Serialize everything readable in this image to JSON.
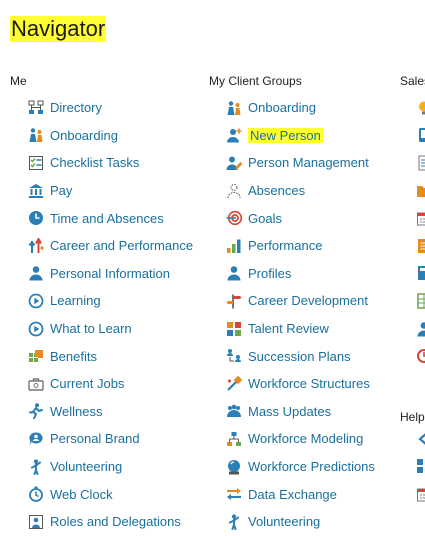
{
  "navigator": {
    "title": "Navigator"
  },
  "colors": {
    "link": "#19709e",
    "highlight": "#ffff33",
    "icon_blue": "#2b7fb7",
    "icon_orange": "#e58a1f",
    "icon_red": "#d9453b",
    "icon_green": "#6aa84f"
  },
  "columns": [
    {
      "header": "Me",
      "items": [
        {
          "label": "Directory",
          "icon": "org-chart-icon"
        },
        {
          "label": "Onboarding",
          "icon": "onboarding-people-icon"
        },
        {
          "label": "Checklist Tasks",
          "icon": "checklist-icon"
        },
        {
          "label": "Pay",
          "icon": "bank-icon"
        },
        {
          "label": "Time and Absences",
          "icon": "clock-icon"
        },
        {
          "label": "Career and Performance",
          "icon": "career-arrows-icon"
        },
        {
          "label": "Personal Information",
          "icon": "person-icon"
        },
        {
          "label": "Learning",
          "icon": "play-circle-icon"
        },
        {
          "label": "What to Learn",
          "icon": "play-circle-icon"
        },
        {
          "label": "Benefits",
          "icon": "benefits-icon"
        },
        {
          "label": "Current Jobs",
          "icon": "briefcase-icon"
        },
        {
          "label": "Wellness",
          "icon": "runner-icon"
        },
        {
          "label": "Personal Brand",
          "icon": "brand-bubble-icon"
        },
        {
          "label": "Volunteering",
          "icon": "volunteer-icon"
        },
        {
          "label": "Web Clock",
          "icon": "stopwatch-icon"
        },
        {
          "label": "Roles and Delegations",
          "icon": "roles-icon"
        }
      ]
    },
    {
      "header": "My Client Groups",
      "items": [
        {
          "label": "Onboarding",
          "icon": "onboarding-people-icon"
        },
        {
          "label": "New Person",
          "icon": "new-person-icon",
          "highlighted": true
        },
        {
          "label": "Person Management",
          "icon": "person-edit-icon"
        },
        {
          "label": "Absences",
          "icon": "absence-person-icon"
        },
        {
          "label": "Goals",
          "icon": "target-icon"
        },
        {
          "label": "Performance",
          "icon": "bar-chart-icon"
        },
        {
          "label": "Profiles",
          "icon": "person-icon"
        },
        {
          "label": "Career Development",
          "icon": "signpost-icon"
        },
        {
          "label": "Talent Review",
          "icon": "talent-grid-icon"
        },
        {
          "label": "Succession Plans",
          "icon": "succession-icon"
        },
        {
          "label": "Workforce Structures",
          "icon": "structure-icon"
        },
        {
          "label": "Mass Updates",
          "icon": "group-icon"
        },
        {
          "label": "Workforce Modeling",
          "icon": "model-tree-icon"
        },
        {
          "label": "Workforce Predictions",
          "icon": "crystal-ball-icon"
        },
        {
          "label": "Data Exchange",
          "icon": "exchange-arrows-icon"
        },
        {
          "label": "Volunteering",
          "icon": "volunteer-icon"
        }
      ]
    },
    {
      "header": "Sales",
      "items": [
        {
          "label": "",
          "icon": "lightbulb-icon"
        },
        {
          "label": "",
          "icon": "phone-icon"
        },
        {
          "label": "",
          "icon": "document-icon"
        },
        {
          "label": "",
          "icon": "folder-icon"
        },
        {
          "label": "",
          "icon": "calendar-icon"
        },
        {
          "label": "",
          "icon": "report-icon"
        },
        {
          "label": "",
          "icon": "book-icon"
        },
        {
          "label": "",
          "icon": "sheet-icon"
        },
        {
          "label": "",
          "icon": "person-icon"
        },
        {
          "label": "",
          "icon": "forecast-icon"
        }
      ]
    },
    {
      "header": "Help",
      "items": [
        {
          "label": "",
          "icon": "back-arrow-icon"
        },
        {
          "label": "",
          "icon": "grid-icon"
        },
        {
          "label": "",
          "icon": "calendar-icon"
        }
      ]
    }
  ]
}
